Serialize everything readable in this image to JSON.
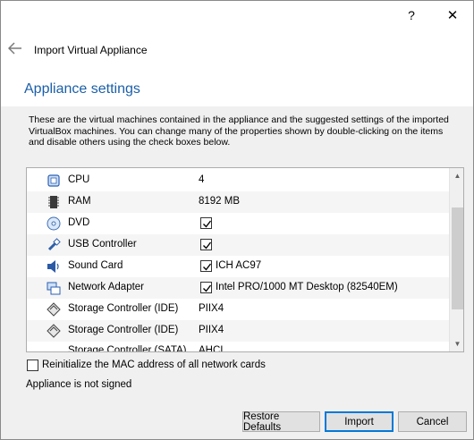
{
  "titlebar": {
    "help_label": "?",
    "close_label": "✕"
  },
  "header": {
    "wizard_title": "Import Virtual Appliance",
    "page_title": "Appliance settings"
  },
  "description": "These are the virtual machines contained in the appliance and the suggested settings of the imported VirtualBox machines. You can change many of the properties shown by double-clicking on the items and disable others using the check boxes below.",
  "rows": [
    {
      "icon": "cpu-icon",
      "name": "CPU",
      "value": "4"
    },
    {
      "icon": "ram-icon",
      "name": "RAM",
      "value": "8192 MB"
    },
    {
      "icon": "dvd-icon",
      "name": "DVD",
      "checked": true,
      "value": ""
    },
    {
      "icon": "usb-icon",
      "name": "USB Controller",
      "checked": true,
      "value": ""
    },
    {
      "icon": "sound-icon",
      "name": "Sound Card",
      "checked": true,
      "value": "ICH AC97"
    },
    {
      "icon": "network-icon",
      "name": "Network Adapter",
      "checked": true,
      "value": "Intel PRO/1000 MT Desktop (82540EM)"
    },
    {
      "icon": "storage-icon",
      "name": "Storage Controller (IDE)",
      "value": "PIIX4"
    },
    {
      "icon": "storage-icon",
      "name": "Storage Controller (IDE)",
      "value": "PIIX4"
    },
    {
      "icon": "storage-icon",
      "name": "Storage Controller (SATA)",
      "value": "AHCI"
    }
  ],
  "reinit_mac": {
    "label": "Reinitialize the MAC address of all network cards",
    "checked": false
  },
  "signature_status": "Appliance is not signed",
  "buttons": {
    "restore": "Restore Defaults",
    "import": "Import",
    "cancel": "Cancel"
  },
  "colors": {
    "title_blue": "#1b5fa8",
    "default_button_border": "#0078d7"
  }
}
